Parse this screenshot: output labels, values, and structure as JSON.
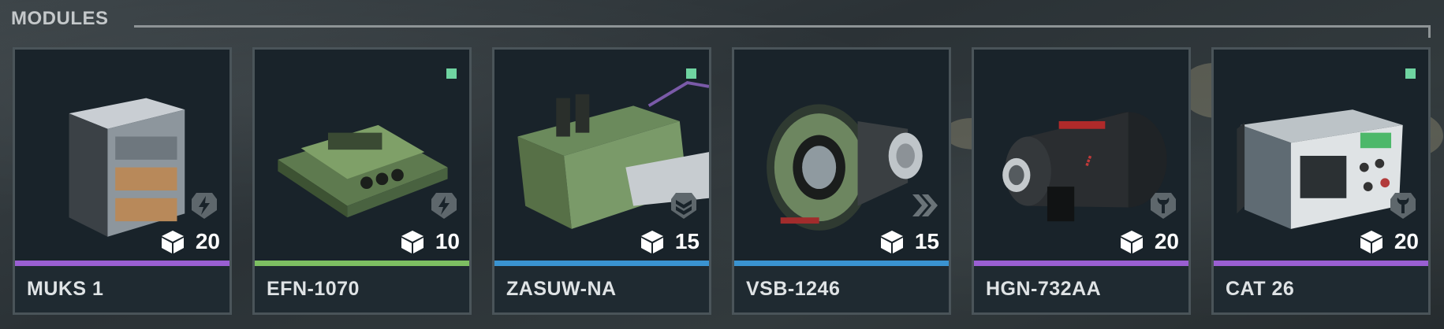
{
  "header": {
    "title": "MODULES"
  },
  "colors": {
    "purple": "#9a5fd2",
    "green": "#7dbf62",
    "blue": "#3a93d0",
    "new_indicator": "#6fd4a1"
  },
  "modules": [
    {
      "name": "MUKS 1",
      "cost": "20",
      "rarity_color": "#9a5fd2",
      "type_icon": "lightning-shield-icon",
      "is_new": false
    },
    {
      "name": "EFN-1070",
      "cost": "10",
      "rarity_color": "#7dbf62",
      "type_icon": "lightning-shield-icon",
      "is_new": true
    },
    {
      "name": "ZASUW-NA",
      "cost": "15",
      "rarity_color": "#3a93d0",
      "type_icon": "chevrons-shield-icon",
      "is_new": true
    },
    {
      "name": "VSB-1246",
      "cost": "15",
      "rarity_color": "#3a93d0",
      "type_icon": "double-chevron-icon",
      "is_new": false
    },
    {
      "name": "HGN-732AA",
      "cost": "20",
      "rarity_color": "#9a5fd2",
      "type_icon": "wrench-shield-icon",
      "is_new": false
    },
    {
      "name": "CAT 26",
      "cost": "20",
      "rarity_color": "#9a5fd2",
      "type_icon": "wrench-shield-icon",
      "is_new": true
    }
  ]
}
